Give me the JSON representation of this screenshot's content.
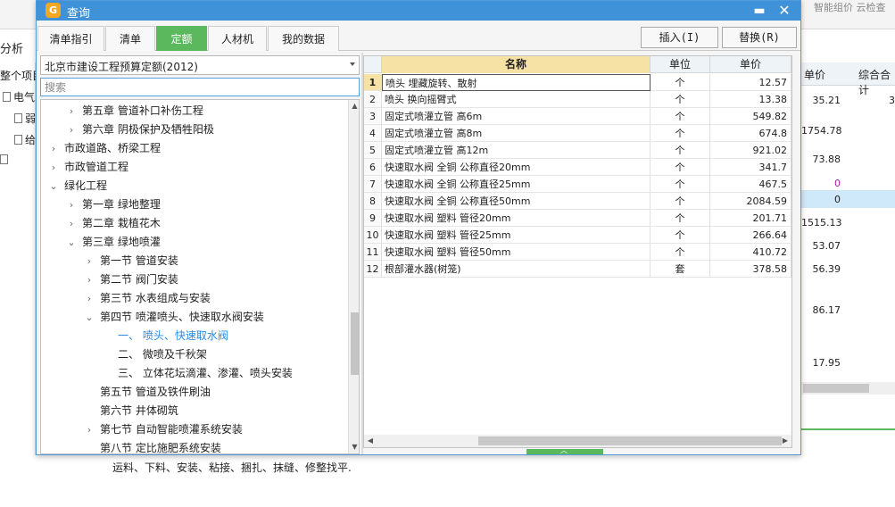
{
  "background": {
    "top_right_text": "智能组价  云检查",
    "fenxi": "分析",
    "left_tree": [
      {
        "label": "整个项目",
        "icon": false
      },
      {
        "label": "电气",
        "icon": true
      },
      {
        "label": "弱",
        "icon": true
      },
      {
        "label": "给",
        "icon": true
      },
      {
        "label": "",
        "icon": true
      }
    ],
    "right_headers": [
      "单价",
      "综合合计"
    ],
    "right_values": [
      {
        "value": "35.21",
        "purple": false
      },
      {
        "value": "3",
        "purple": false
      },
      {
        "value": "1754.78",
        "purple": false
      },
      {
        "value": "73.88",
        "purple": false
      },
      {
        "value": "0",
        "purple": true
      },
      {
        "value": "0",
        "purple": false
      },
      {
        "value": "1515.13",
        "purple": false
      },
      {
        "value": "53.07",
        "purple": false
      },
      {
        "value": "56.39",
        "purple": false
      },
      {
        "value": "86.17",
        "purple": false
      },
      {
        "value": "17.95",
        "purple": false
      }
    ],
    "description": "运料、下料、安装、粘接、捆扎、抹缝、修整找平."
  },
  "dialog": {
    "title": "查询",
    "minimize_glyph": "▬",
    "close_glyph": "✕",
    "tabs": [
      {
        "label": "清单指引",
        "active": false
      },
      {
        "label": "清单",
        "active": false
      },
      {
        "label": "定额",
        "active": true
      },
      {
        "label": "人材机",
        "active": false
      },
      {
        "label": "我的数据",
        "active": false
      }
    ],
    "insert_button": "插入(I)",
    "replace_button": "替换(R)",
    "quota_library": "北京市建设工程预算定额(2012)",
    "search_placeholder": "搜索",
    "tree": [
      {
        "label": "第五章 管道补口补伤工程",
        "level": 1,
        "arrow": "right",
        "selected": false
      },
      {
        "label": "第六章 阴极保护及牺牲阳极",
        "level": 1,
        "arrow": "right",
        "selected": false
      },
      {
        "label": "市政道路、桥梁工程",
        "level": 0,
        "arrow": "right",
        "selected": false
      },
      {
        "label": "市政管道工程",
        "level": 0,
        "arrow": "right",
        "selected": false
      },
      {
        "label": "绿化工程",
        "level": 0,
        "arrow": "down",
        "selected": false
      },
      {
        "label": "第一章 绿地整理",
        "level": 1,
        "arrow": "right",
        "selected": false
      },
      {
        "label": "第二章 栽植花木",
        "level": 1,
        "arrow": "right",
        "selected": false
      },
      {
        "label": "第三章 绿地喷灌",
        "level": 1,
        "arrow": "down",
        "selected": false
      },
      {
        "label": "第一节 管道安装",
        "level": 2,
        "arrow": "right",
        "selected": false
      },
      {
        "label": "第二节 阀门安装",
        "level": 2,
        "arrow": "right",
        "selected": false
      },
      {
        "label": "第三节 水表组成与安装",
        "level": 2,
        "arrow": "right",
        "selected": false
      },
      {
        "label": "第四节 喷灌喷头、快速取水阀安装",
        "level": 2,
        "arrow": "down",
        "selected": false
      },
      {
        "label": "一、  喷头、快速取水阀",
        "level": 3,
        "arrow": "none",
        "selected": true
      },
      {
        "label": "二、  微喷及千秋架",
        "level": 3,
        "arrow": "none",
        "selected": false
      },
      {
        "label": "三、  立体花坛滴灌、渗灌、喷头安装",
        "level": 3,
        "arrow": "none",
        "selected": false
      },
      {
        "label": "第五节 管道及铁件刷油",
        "level": 2,
        "arrow": "none",
        "selected": false
      },
      {
        "label": "第六节 井体砌筑",
        "level": 2,
        "arrow": "none",
        "selected": false
      },
      {
        "label": "第七节 自动智能喷灌系统安装",
        "level": 2,
        "arrow": "right",
        "selected": false
      },
      {
        "label": "第八节 定比施肥系统安装",
        "level": 2,
        "arrow": "none",
        "selected": false
      }
    ],
    "grid": {
      "headers": {
        "index": "",
        "name": "名称",
        "unit": "单位",
        "price": "单价"
      },
      "rows": [
        {
          "index": "1",
          "name": "喷头 埋藏旋转、散射",
          "unit": "个",
          "price": "12.57"
        },
        {
          "index": "2",
          "name": "喷头 换向摇臂式",
          "unit": "个",
          "price": "13.38"
        },
        {
          "index": "3",
          "name": "固定式喷灌立管 高6m",
          "unit": "个",
          "price": "549.82"
        },
        {
          "index": "4",
          "name": "固定式喷灌立管 高8m",
          "unit": "个",
          "price": "674.8"
        },
        {
          "index": "5",
          "name": "固定式喷灌立管 高12m",
          "unit": "个",
          "price": "921.02"
        },
        {
          "index": "6",
          "name": "快速取水阀 全铜 公称直径20mm",
          "unit": "个",
          "price": "341.7"
        },
        {
          "index": "7",
          "name": "快速取水阀 全铜 公称直径25mm",
          "unit": "个",
          "price": "467.5"
        },
        {
          "index": "8",
          "name": "快速取水阀 全铜 公称直径50mm",
          "unit": "个",
          "price": "2084.59"
        },
        {
          "index": "9",
          "name": "快速取水阀 塑料 管径20mm",
          "unit": "个",
          "price": "201.71"
        },
        {
          "index": "10",
          "name": "快速取水阀 塑料 管径25mm",
          "unit": "个",
          "price": "266.64"
        },
        {
          "index": "11",
          "name": "快速取水阀 塑料 管径50mm",
          "unit": "个",
          "price": "410.72"
        },
        {
          "index": "12",
          "name": "根部灌水器(树笼)",
          "unit": "套",
          "price": "378.58"
        }
      ]
    }
  },
  "colors": {
    "title_bar": "#3f92d8",
    "active_tab": "#5cb85c",
    "header_highlight": "#f7e2a6",
    "selected_tree_text": "#2a8ae0"
  }
}
